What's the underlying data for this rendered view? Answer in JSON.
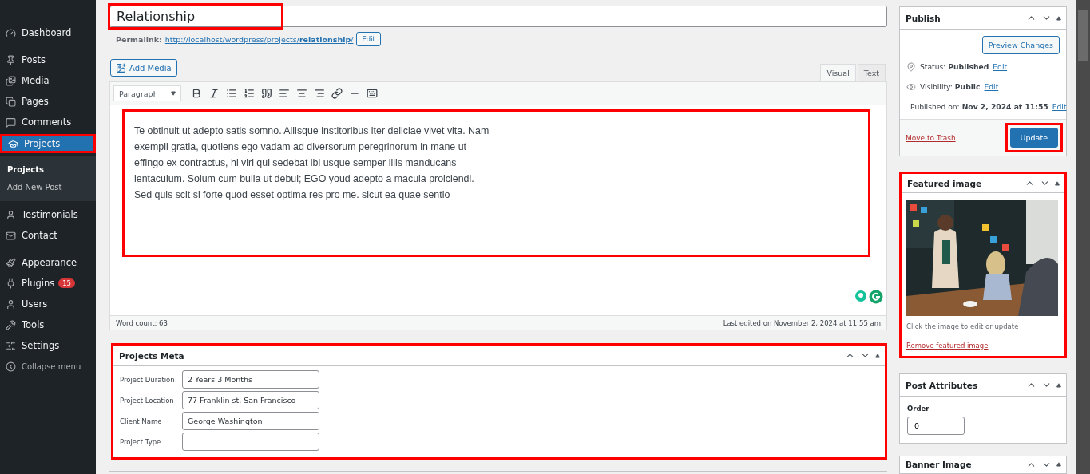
{
  "sidebar": {
    "items": [
      {
        "label": "Dashboard",
        "selected": false,
        "highlighted": false,
        "gap_after": true
      },
      {
        "label": "Posts",
        "selected": false,
        "highlighted": false
      },
      {
        "label": "Media",
        "selected": false,
        "highlighted": false
      },
      {
        "label": "Pages",
        "selected": false,
        "highlighted": false
      },
      {
        "label": "Comments",
        "selected": false,
        "highlighted": false
      },
      {
        "label": "Projects",
        "selected": true,
        "highlighted": true,
        "children": [
          {
            "label": "Projects",
            "selected": true
          },
          {
            "label": "Add New Post",
            "selected": false
          }
        ]
      },
      {
        "label": "Testimonials",
        "selected": false,
        "highlighted": false
      },
      {
        "label": "Contact",
        "selected": false,
        "highlighted": false,
        "gap_after": true
      },
      {
        "label": "Appearance",
        "selected": false,
        "highlighted": false
      },
      {
        "label": "Plugins",
        "selected": false,
        "highlighted": false,
        "badge": "15"
      },
      {
        "label": "Users",
        "selected": false,
        "highlighted": false
      },
      {
        "label": "Tools",
        "selected": false,
        "highlighted": false
      },
      {
        "label": "Settings",
        "selected": false,
        "highlighted": false
      }
    ],
    "collapse": "Collapse menu"
  },
  "title": {
    "value": "Relationship",
    "highlighted": true
  },
  "permalink": {
    "label": "Permalink:",
    "url": "http://localhost/wordpress/projects/**relationship**/",
    "edit": "Edit"
  },
  "editor": {
    "add_media": "Add Media",
    "tabs": [
      {
        "label": "Visual",
        "selected": true
      },
      {
        "label": "Text",
        "selected": false
      }
    ],
    "format": "Paragraph",
    "highlighted": true,
    "lines": [
      "Te obtinuit ut adepto satis somno. Aliisque institoribus iter deliciae vivet vita. Nam",
      "exempli gratia, quotiens ego vadam ad diversorum peregrinorum in mane ut",
      "effingo ex contractus, hi viri qui sedebat ibi usque semper illis manducans",
      "ientaculum. Solum cum bulla ut debui; EGO youd adepto a macula proiciendi.",
      "Sed quis scit si forte quod esset optima res pro me. sicut ea quae sentio"
    ],
    "word_count": "Word count: 63",
    "last_edited": "Last edited on November 2, 2024 at 11:55 am"
  },
  "projects_meta": {
    "title": "Projects Meta",
    "highlighted": true,
    "fields": [
      {
        "label": "Project Duration",
        "value": "2 Years 3 Months"
      },
      {
        "label": "Project Location",
        "value": "77 Franklin st, San Francisco"
      },
      {
        "label": "Client Name",
        "value": "George Washington"
      },
      {
        "label": "Project Type"
      }
    ]
  },
  "publish": {
    "title": "Publish",
    "preview": "Preview Changes",
    "rows": [
      {
        "label": "Status:",
        "value": "Published",
        "edit": "Edit"
      },
      {
        "label": "Visibility:",
        "value": "Public",
        "edit": "Edit"
      },
      {
        "label": "Published on:",
        "value": "Nov 2, 2024 at 11:55",
        "edit": "Edit"
      }
    ],
    "trash": "Move to Trash",
    "update": "Update",
    "update_highlighted": true
  },
  "featured_image": {
    "title": "Featured image",
    "highlighted": true,
    "hint": "Click the image to edit or update",
    "remove": "Remove featured image"
  },
  "post_attributes": {
    "title": "Post Attributes",
    "order_label": "Order",
    "order_value": "0"
  },
  "banner_image": {
    "title": "Banner Image"
  }
}
